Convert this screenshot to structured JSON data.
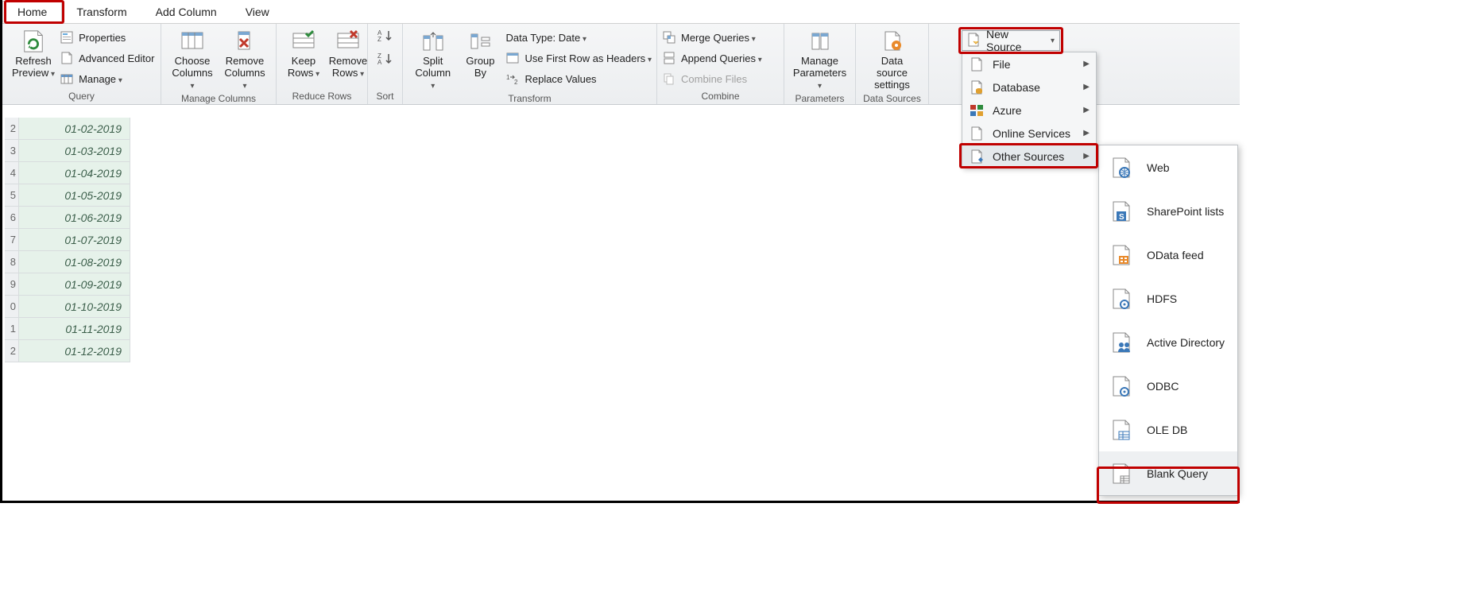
{
  "tabs": {
    "home": "Home",
    "transform": "Transform",
    "addcol": "Add Column",
    "view": "View"
  },
  "groups": {
    "query": "Query",
    "manageCols": "Manage Columns",
    "reduceRows": "Reduce Rows",
    "sort": "Sort",
    "transform": "Transform",
    "combine": "Combine",
    "parameters": "Parameters",
    "dataSources": "Data Sources"
  },
  "btn": {
    "refresh": "Refresh\nPreview",
    "properties": "Properties",
    "advEditor": "Advanced Editor",
    "manage": "Manage",
    "chooseCols": "Choose\nColumns",
    "removeCols": "Remove\nColumns",
    "keepRows": "Keep\nRows",
    "removeRows": "Remove\nRows",
    "splitCol": "Split\nColumn",
    "groupBy": "Group\nBy",
    "dataType": "Data Type: Date",
    "firstRow": "Use First Row as Headers",
    "replace": "Replace Values",
    "merge": "Merge Queries",
    "append": "Append Queries",
    "combineFiles": "Combine Files",
    "manageParams": "Manage\nParameters",
    "dsSettings": "Data source\nsettings",
    "newSource": "New Source"
  },
  "menu1": {
    "file": "File",
    "database": "Database",
    "azure": "Azure",
    "online": "Online Services",
    "other": "Other Sources"
  },
  "menu2": {
    "web": "Web",
    "sp": "SharePoint lists",
    "odata": "OData feed",
    "hdfs": "HDFS",
    "ad": "Active Directory",
    "odbc": "ODBC",
    "oledb": "OLE DB",
    "blank": "Blank Query"
  },
  "rows": [
    {
      "n": "2",
      "v": "01-02-2019"
    },
    {
      "n": "3",
      "v": "01-03-2019"
    },
    {
      "n": "4",
      "v": "01-04-2019"
    },
    {
      "n": "5",
      "v": "01-05-2019"
    },
    {
      "n": "6",
      "v": "01-06-2019"
    },
    {
      "n": "7",
      "v": "01-07-2019"
    },
    {
      "n": "8",
      "v": "01-08-2019"
    },
    {
      "n": "9",
      "v": "01-09-2019"
    },
    {
      "n": "0",
      "v": "01-10-2019"
    },
    {
      "n": "1",
      "v": "01-11-2019"
    },
    {
      "n": "2",
      "v": "01-12-2019"
    }
  ]
}
